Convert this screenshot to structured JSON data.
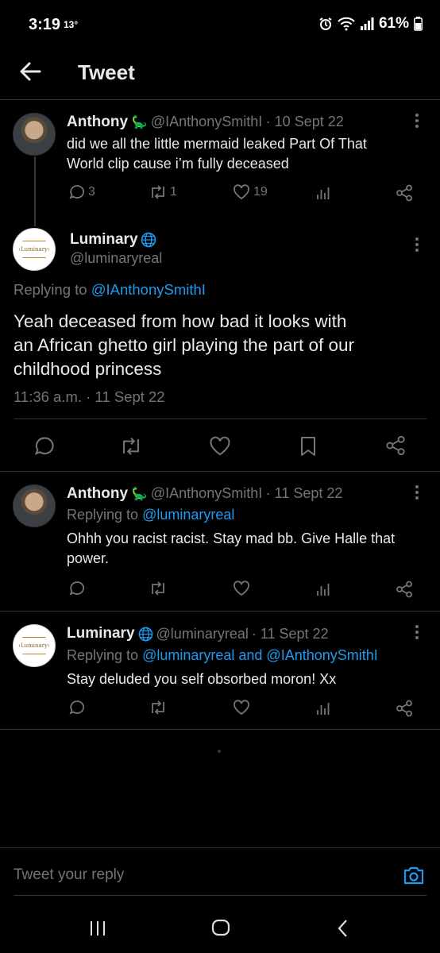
{
  "status_bar": {
    "time": "3:19",
    "temperature": "13°",
    "battery": "61%"
  },
  "header": {
    "title": "Tweet"
  },
  "parent_tweet": {
    "name": "Anthony",
    "emoji": "🦕",
    "handle": "@IAnthonySmithI",
    "date": "· 10 Sept 22",
    "text_line1": "did we all the little mermaid leaked Part Of That",
    "text_line2": "World clip cause i’m fully deceased",
    "replies": "3",
    "retweets": "1",
    "likes": "19"
  },
  "main_tweet": {
    "name": "Luminary",
    "handle": "@luminaryreal",
    "avatar_text": "Luminary",
    "replying_prefix": "Replying to",
    "replying_to": "@IAnthonySmithI",
    "text_line1": "Yeah deceased from how bad it looks with",
    "text_line2": "an African ghetto girl playing the part of our",
    "text_line3": "childhood princess",
    "timestamp": "11:36 a.m. · 11 Sept 22"
  },
  "reply1": {
    "name": "Anthony",
    "emoji": "🦕",
    "handle": "@IAnthonySmithI",
    "date": "· 11 Sept 22",
    "replying_prefix": "Replying to",
    "replying_to": "@luminaryreal",
    "text_line1": "Ohhh you racist racist. Stay mad bb. Give Halle that",
    "text_line2": "power."
  },
  "reply2": {
    "name": "Luminary",
    "handle": "@luminaryreal",
    "date": "· 11 Sept 22",
    "avatar_text": "Luminary",
    "replying_prefix": "Replying to",
    "replying_to": "@luminaryreal and @IAnthonySmithI",
    "text_line1": "Stay deluded you self obsorbed moron! Xx"
  },
  "composer": {
    "placeholder": "Tweet your reply"
  },
  "colors": {
    "background": "#000000",
    "accent": "#1d9bf0",
    "muted": "#71767b",
    "text": "#e7e9ea",
    "divider": "#2f3336"
  }
}
